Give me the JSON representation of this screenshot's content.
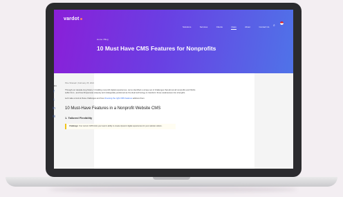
{
  "nav": {
    "logo": "vardot",
    "items": [
      "Solutions",
      "Services",
      "Clients",
      "Ideas",
      "About",
      "Contact Us"
    ],
    "active": "Ideas",
    "icons": [
      "search-icon",
      "flag-icon"
    ]
  },
  "breadcrumb": "Home / Blog",
  "article": {
    "title": "10 Must Have CMS Features for Nonprofits",
    "share_label": "Share",
    "share_icons": [
      "facebook-icon",
      "twitter-icon",
      "linkedin-icon",
      "email-icon"
    ],
    "meta": "Pine Sharaeh  |  February 25, 2021",
    "para1": "Through our decade-long history in building nonprofit digital experiences, we've identified a unique set of challenges that almost all nonprofits and NGOs suffer from - and how Drupal was uniquely and strategically positioned as the ideal technology to transform those weaknesses into strengths.",
    "para2_prefix": "Let's take a look at those challenges and how ",
    "para2_link": "choosing the right CMS features",
    "para2_suffix": " address them.",
    "h2": "10 Must-Have Features in a Nonprofit Website CMS",
    "h3": "1. Tailored Flexibility",
    "callout_label": "Challenge:",
    "callout_text": " Your current CMS limits your team's ability to create dynamic digital experiences for your website visitors."
  },
  "colors": {
    "hero_start": "#8a1fd8",
    "hero_end": "#4f73e8",
    "link": "#2563eb",
    "callout_border": "#f0c419"
  }
}
